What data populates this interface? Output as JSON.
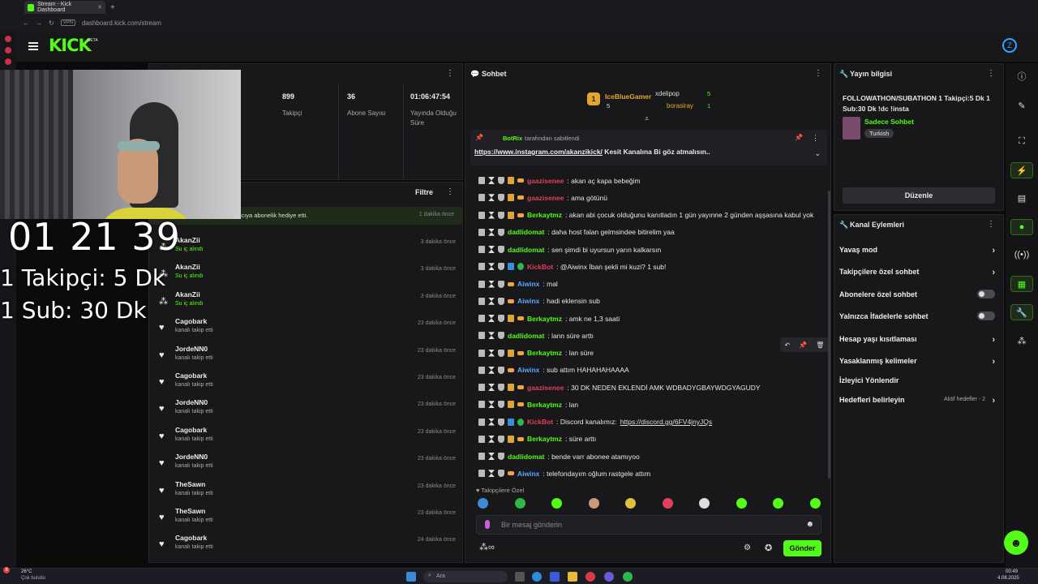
{
  "browser": {
    "tab_title": "Stream - Kick Dashboard",
    "url": "dashboard.kick.com/stream",
    "vpn_badge": "VPN"
  },
  "app": {
    "logo": "KICK",
    "beta": "BETA",
    "avatar_letter": "Z"
  },
  "stats": [
    {
      "value": "899",
      "label": "Takipçi"
    },
    {
      "value": "36",
      "label": "Abone Sayısı"
    },
    {
      "value": "01:06:47:54",
      "label": "Yayında Olduğu Süre"
    }
  ],
  "activity": {
    "filter_label": "Filtre",
    "banner": "1, Cagobark isimli kullanıcıya abonelik hediye etti.",
    "banner_time": "1 dakika önce",
    "rows": [
      {
        "name": "AkanZii",
        "sub": "Su iç alındı",
        "time": "3 dakika önce",
        "icon": "reward-icon",
        "green": true
      },
      {
        "name": "AkanZii",
        "sub": "Su iç alındı",
        "time": "3 dakika önce",
        "icon": "reward-icon",
        "green": true
      },
      {
        "name": "AkanZii",
        "sub": "Su iç alındı",
        "time": "3 dakika önce",
        "icon": "reward-icon",
        "green": true
      },
      {
        "name": "Cagobark",
        "sub": "kanalı takip etti",
        "time": "23 dakika önce",
        "icon": "heart-icon",
        "green": false
      },
      {
        "name": "JordeNN0",
        "sub": "kanalı takip etti",
        "time": "23 dakika önce",
        "icon": "heart-icon",
        "green": false
      },
      {
        "name": "Cagobark",
        "sub": "kanalı takip etti",
        "time": "23 dakika önce",
        "icon": "heart-icon",
        "green": false
      },
      {
        "name": "JordeNN0",
        "sub": "kanalı takip etti",
        "time": "23 dakika önce",
        "icon": "heart-icon",
        "green": false
      },
      {
        "name": "Cagobark",
        "sub": "kanalı takip etti",
        "time": "23 dakika önce",
        "icon": "heart-icon",
        "green": false
      },
      {
        "name": "JordeNN0",
        "sub": "kanalı takip etti",
        "time": "23 dakika önce",
        "icon": "heart-icon",
        "green": false
      },
      {
        "name": "TheSawn",
        "sub": "kanalı takip etti",
        "time": "23 dakika önce",
        "icon": "heart-icon",
        "green": false
      },
      {
        "name": "TheSawn",
        "sub": "kanalı takip etti",
        "time": "23 dakika önce",
        "icon": "heart-icon",
        "green": false
      },
      {
        "name": "Cagobark",
        "sub": "kanalı takip etti",
        "time": "24 dakika önce",
        "icon": "heart-icon",
        "green": false
      }
    ]
  },
  "overlay": {
    "timer": "01 21 39",
    "line1": "1 Takipçi: 5 Dk",
    "line2": "1 Sub: 30 Dk"
  },
  "chat": {
    "title": "Sohbet",
    "leaders": [
      {
        "name": "IceBlueGamer",
        "count": "5",
        "rank": "1"
      },
      {
        "name": "xdelipop",
        "count": "5"
      },
      {
        "name": "borasiray",
        "count": "1"
      }
    ],
    "pinned_by": "BotRix",
    "pinned_by_suffix": "tarafından sabitlendi",
    "pinned_link": "https://www.instagram.com/akanzikick/",
    "pinned_text": " Kesit Kanalına Bi göz atmalısın..",
    "messages": [
      {
        "user": "gaazisenee",
        "color": "#e0405a",
        "text": ": akan aç kapa bebeğim",
        "badges": [
          "crown",
          "sub"
        ]
      },
      {
        "user": "gaazisenee",
        "color": "#e0405a",
        "text": ": ama götünü",
        "badges": [
          "crown",
          "sub"
        ]
      },
      {
        "user": "Berkaytmz",
        "color": "#53fc18",
        "text": ": akan abi çocuk olduğunu kanıtladın 1 gün yayınne 2 günden aşşasına kabul yok",
        "badges": [
          "crown",
          "sub"
        ]
      },
      {
        "user": "dadlidomat",
        "color": "#53fc18",
        "text": ": daha host falan gelmsindee bitirelim yaa",
        "badges": []
      },
      {
        "user": "dadlidomat",
        "color": "#53fc18",
        "text": ": sen şimdi bi uyursun yarın kalkarsın",
        "badges": []
      },
      {
        "user": "KickBot",
        "color": "#e0405a",
        "text": ": @Aiwinx İban şekli mi kuzi? 1 sub!",
        "badges": [
          "bot",
          "ver"
        ]
      },
      {
        "user": "Aiwinx",
        "color": "#5aa7ff",
        "text": ": mal",
        "badges": [
          "sub"
        ]
      },
      {
        "user": "Aiwinx",
        "color": "#5aa7ff",
        "text": ": hadi eklensin sub",
        "badges": [
          "sub"
        ]
      },
      {
        "user": "Berkaytmz",
        "color": "#53fc18",
        "text": ": amk ne 1,3 saati",
        "badges": [
          "crown",
          "sub"
        ]
      },
      {
        "user": "dadlidomat",
        "color": "#53fc18",
        "text": ": lann süre arttı",
        "badges": []
      },
      {
        "user": "Berkaytmz",
        "color": "#53fc18",
        "text": ": lan süre",
        "badges": [
          "crown",
          "sub"
        ]
      },
      {
        "user": "Aiwinx",
        "color": "#5aa7ff",
        "text": ": sub attım HAHAHAHAAAA",
        "badges": [
          "sub"
        ]
      },
      {
        "user": "gaazisenee",
        "color": "#e0405a",
        "text": ": 30 DK NEDEN EKLENDİ AMK WDBADYGBAYWDGYAGUDY",
        "badges": [
          "crown",
          "sub"
        ]
      },
      {
        "user": "Berkaytmz",
        "color": "#53fc18",
        "text": ": lan",
        "badges": [
          "crown",
          "sub"
        ]
      },
      {
        "user": "KickBot",
        "color": "#e0405a",
        "text": ": Discord kanalımız:",
        "link": "https://discord.gg/6FV4jnyJQs",
        "badges": [
          "bot",
          "ver"
        ]
      },
      {
        "user": "Berkaytmz",
        "color": "#53fc18",
        "text": ": süre arttı",
        "badges": [
          "crown",
          "sub"
        ]
      },
      {
        "user": "dadlidomat",
        "color": "#53fc18",
        "text": ": bende varr abonee atamıyoo",
        "badges": []
      },
      {
        "user": "Aiwinx",
        "color": "#5aa7ff",
        "text": ": telefondayım oğlum rastgele attım",
        "badges": [
          "sub"
        ]
      }
    ],
    "mode_label": "Takipçilere Özel",
    "input_placeholder": "Bir mesaj gönderin",
    "send_label": "Gönder",
    "infinity": "∞"
  },
  "stream_info": {
    "title": "Yayın bilgisi",
    "stream_title": "FOLLOWATHON/SUBATHON 1 Takipçi:5 Dk 1 Sub:30 Dk !dc !insta",
    "category": "Sadece Sohbet",
    "tag": "Turkish",
    "edit_label": "Düzenle"
  },
  "channel_actions": {
    "title": "Kanal Eylemleri",
    "items": [
      {
        "label": "Yavaş mod",
        "control": "chevron"
      },
      {
        "label": "Takipçilere özel sohbet",
        "control": "chevron"
      },
      {
        "label": "Abonelere özel sohbet",
        "control": "toggle"
      },
      {
        "label": "Yalnızca İfadelerle sohbet",
        "control": "toggle"
      },
      {
        "label": "Hesap yaşı kısıtlaması",
        "control": "chevron"
      },
      {
        "label": "Yasaklanmış kelimeler",
        "control": "chevron"
      },
      {
        "label": "İzleyici Yönlendir",
        "control": "none"
      },
      {
        "label": "Hedefleri belirleyin",
        "control": "chevron",
        "extra": "Aktif hedefler - 2"
      }
    ]
  },
  "taskbar": {
    "weather_temp": "26°C",
    "weather_text": "Çok bulutlu",
    "search_placeholder": "Ara",
    "notif_count": "8",
    "time": "00:49",
    "date": "4.08.2025"
  },
  "colors": {
    "accent": "#53fc18",
    "bg": "#0b0b0c",
    "panel": "#18181b"
  }
}
